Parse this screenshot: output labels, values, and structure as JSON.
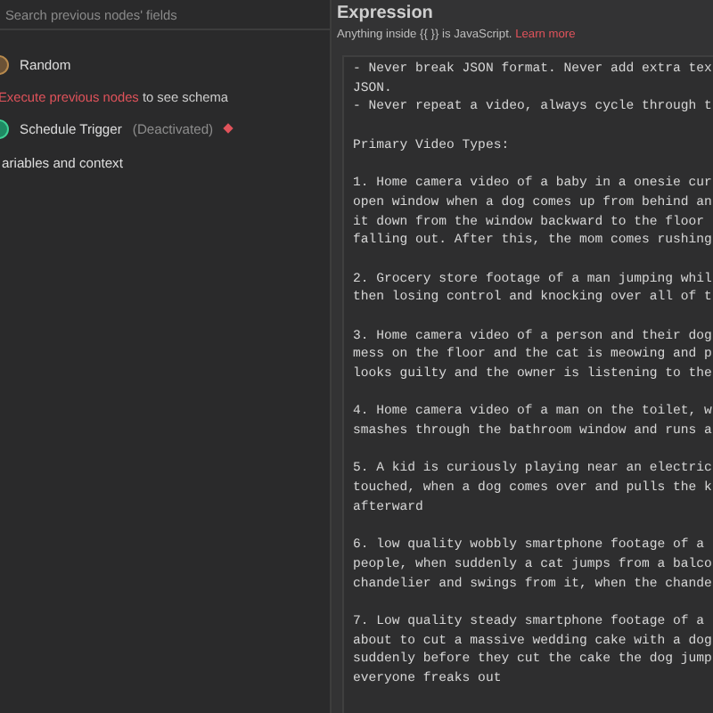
{
  "left": {
    "search": {
      "placeholder": "Search previous nodes' fields"
    },
    "items": [
      {
        "kind": "node",
        "name": "Random"
      },
      {
        "kind": "hint",
        "link": "Execute previous nodes",
        "text": " to see schema"
      },
      {
        "kind": "trigger",
        "name": "Schedule Trigger",
        "status": "(Deactivated)",
        "warning": true
      },
      {
        "kind": "section",
        "name": "ariables and context"
      }
    ]
  },
  "right": {
    "title": "Expression",
    "hint": "Anything inside {{ }} is JavaScript.",
    "hint_link": "Learn more",
    "paragraphs": [
      [
        "- Never break JSON format. Never add extra tex",
        "JSON.",
        "- Never repeat a video, always cycle through t"
      ],
      [
        "Primary Video Types:"
      ],
      [
        "1. Home camera video of a baby in a onesie cur",
        "open window when a dog comes up from behind an",
        "it down from the window backward to the floor",
        "falling out. After this, the mom comes rushing"
      ],
      [
        "2. Grocery store footage of a man jumping whil",
        "then losing control and knocking over all of t"
      ],
      [
        "3. Home camera video of a person and their dog",
        "mess on the floor and the cat is meowing and p",
        "looks guilty and the owner is listening to the"
      ],
      [
        "4. Home camera video of a man on the toilet, w",
        "smashes through the bathroom window and runs a"
      ],
      [
        "5. A kid is curiously playing near an electric",
        "touched, when a dog comes over and pulls the k",
        "afterward"
      ],
      [
        "6. low quality wobbly smartphone footage of a",
        "people, when suddenly a cat jumps from a balco",
        "chandelier and swings from it, when the chande"
      ],
      [
        "7. Low quality steady smartphone footage of a",
        "about to cut a massive wedding cake with a dog",
        "suddenly before they cut the cake the dog jump",
        "everyone freaks out"
      ]
    ]
  }
}
